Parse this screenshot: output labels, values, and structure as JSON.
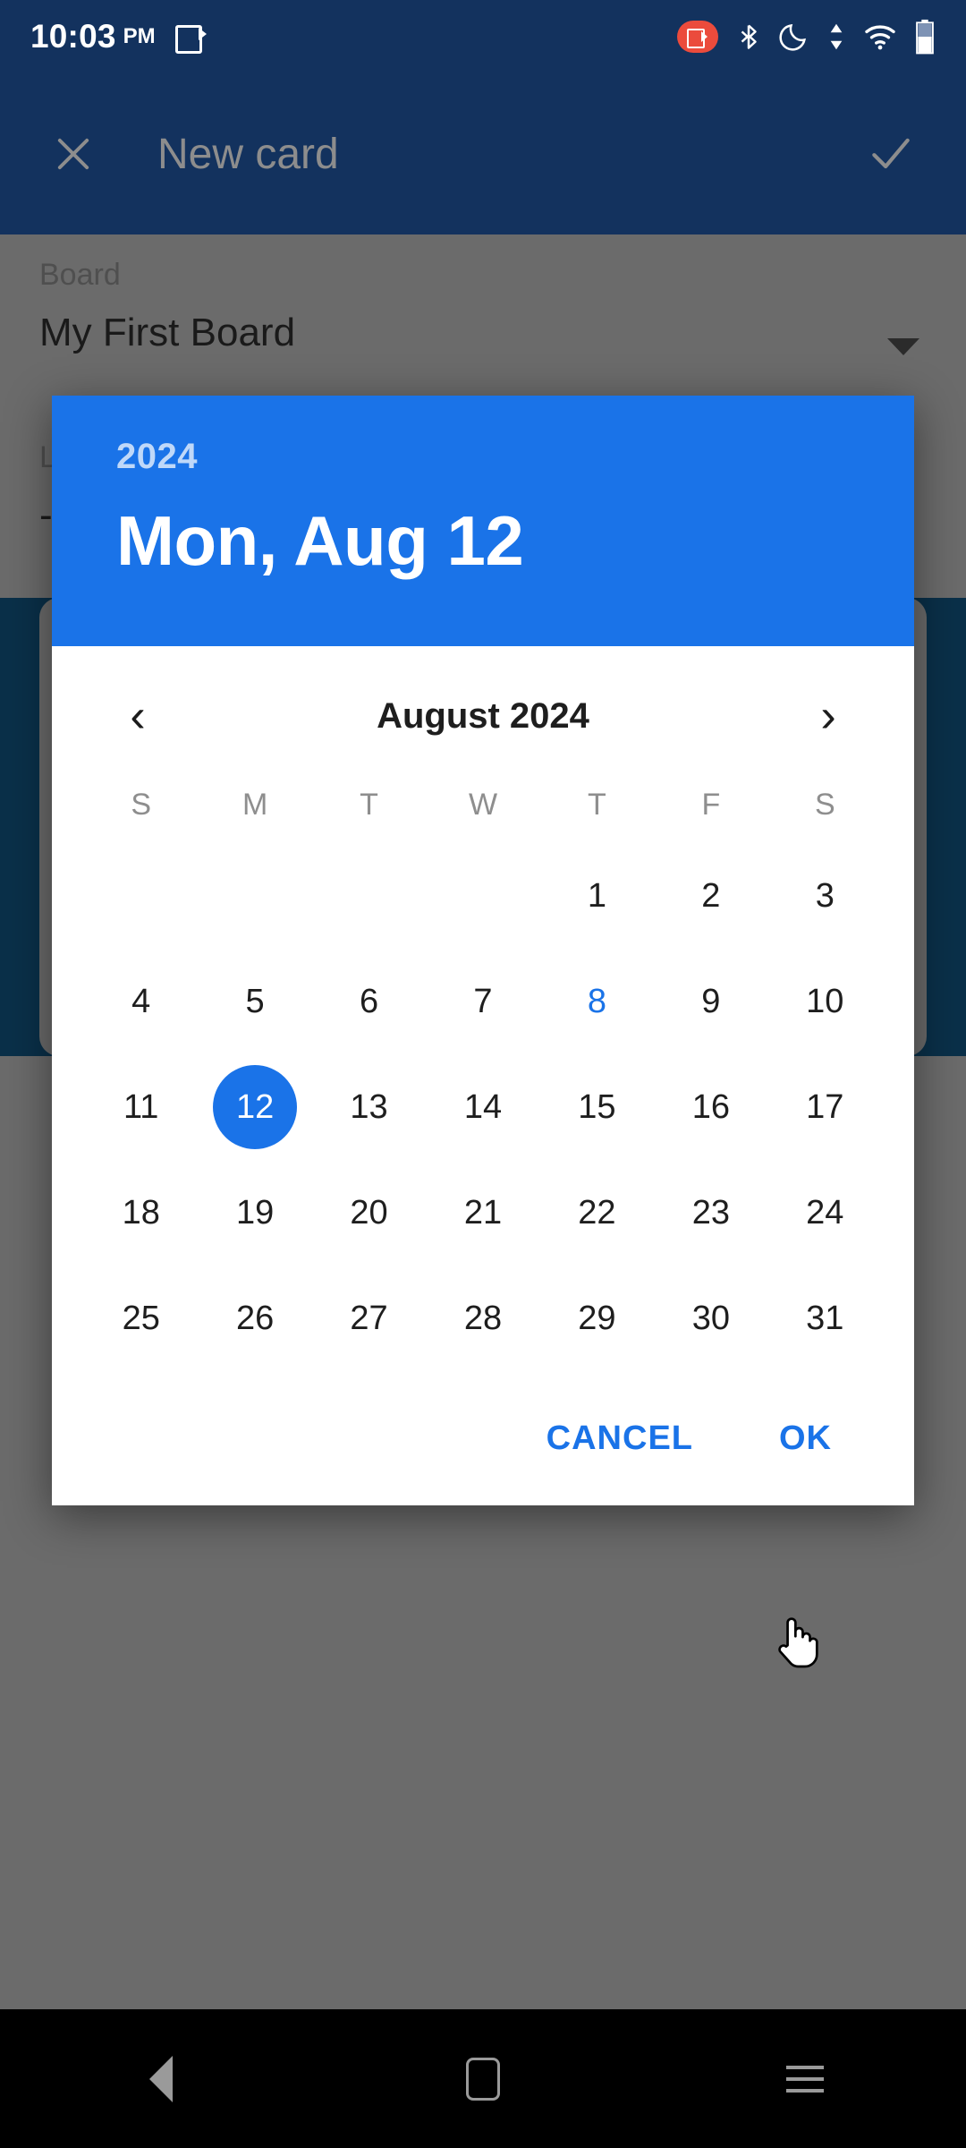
{
  "status_bar": {
    "time": "10:03",
    "ampm": "PM",
    "icons": [
      "screen-cast-icon",
      "screen-record-icon",
      "bluetooth-icon",
      "do-not-disturb-icon",
      "mobile-data-icon",
      "wifi-icon",
      "battery-icon"
    ]
  },
  "app_bar": {
    "close_label": "✕",
    "title": "New card",
    "confirm_label": "✓"
  },
  "form": {
    "board_label": "Board",
    "board_value": "My First Board",
    "list_label_partial": "L",
    "list_value_partial": "-"
  },
  "dialog": {
    "header": {
      "year": "2024",
      "date": "Mon, Aug 12"
    },
    "month_nav": {
      "prev_label": "‹",
      "next_label": "›",
      "month_label": "August 2024"
    },
    "weekdays": [
      "S",
      "M",
      "T",
      "W",
      "T",
      "F",
      "S"
    ],
    "weeks": [
      [
        "",
        "",
        "",
        "",
        "1",
        "2",
        "3"
      ],
      [
        "4",
        "5",
        "6",
        "7",
        "8",
        "9",
        "10"
      ],
      [
        "11",
        "12",
        "13",
        "14",
        "15",
        "16",
        "17"
      ],
      [
        "18",
        "19",
        "20",
        "21",
        "22",
        "23",
        "24"
      ],
      [
        "25",
        "26",
        "27",
        "28",
        "29",
        "30",
        "31"
      ]
    ],
    "today": "8",
    "selected": "12",
    "cancel_label": "CANCEL",
    "ok_label": "OK",
    "accent_color": "#1a73e8"
  },
  "nav_bar": {
    "back": "back-icon",
    "home": "home-icon",
    "recents": "recents-icon"
  },
  "colors": {
    "app_bar": "#13325e",
    "scrim": "#6b6b6b",
    "card_body": "#0a3049",
    "accent": "#1a73e8",
    "record_badge": "#eb4b3c"
  }
}
